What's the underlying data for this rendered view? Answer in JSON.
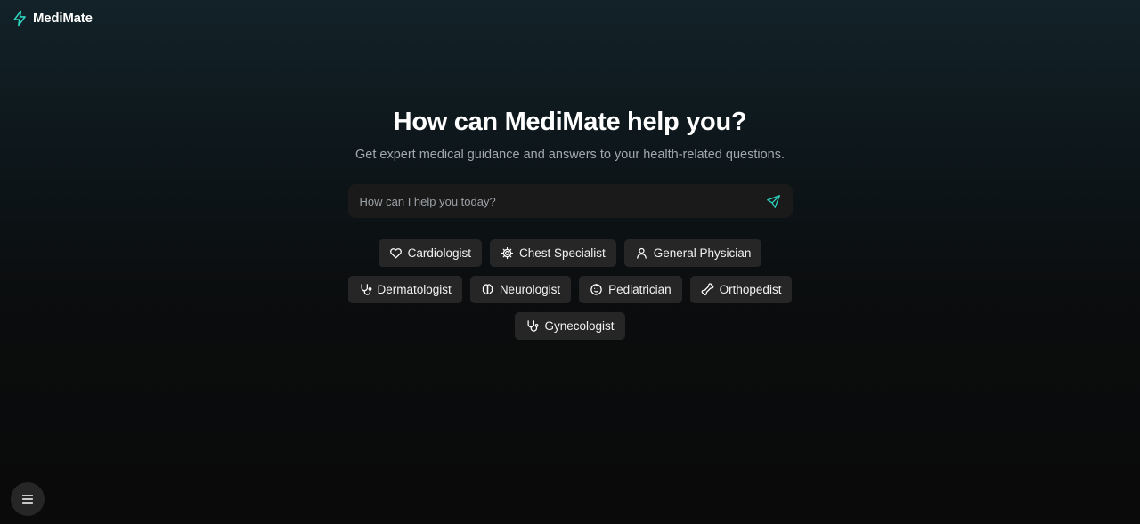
{
  "brand": {
    "name": "MediMate",
    "icon": "zap-icon",
    "accent": "#2dd4bf"
  },
  "hero": {
    "title": "How can MediMate help you?",
    "subtitle": "Get expert medical guidance and answers to your health-related questions."
  },
  "search": {
    "placeholder": "How can I help you today?",
    "value": "",
    "send_icon": "send-icon"
  },
  "specialties": [
    {
      "label": "Cardiologist",
      "icon": "heart-icon"
    },
    {
      "label": "Chest Specialist",
      "icon": "gear-icon"
    },
    {
      "label": "General Physician",
      "icon": "user-icon"
    },
    {
      "label": "Dermatologist",
      "icon": "stethoscope-icon"
    },
    {
      "label": "Neurologist",
      "icon": "brain-icon"
    },
    {
      "label": "Pediatrician",
      "icon": "baby-icon"
    },
    {
      "label": "Orthopedist",
      "icon": "bone-icon"
    },
    {
      "label": "Gynecologist",
      "icon": "stethoscope-icon"
    }
  ],
  "menu": {
    "icon": "menu-icon"
  },
  "colors": {
    "background_top": "#132229",
    "background_bottom": "#0a0a0a",
    "chip_bg": "#262626",
    "input_bg": "#1a1a1a",
    "accent": "#2dd4bf"
  }
}
